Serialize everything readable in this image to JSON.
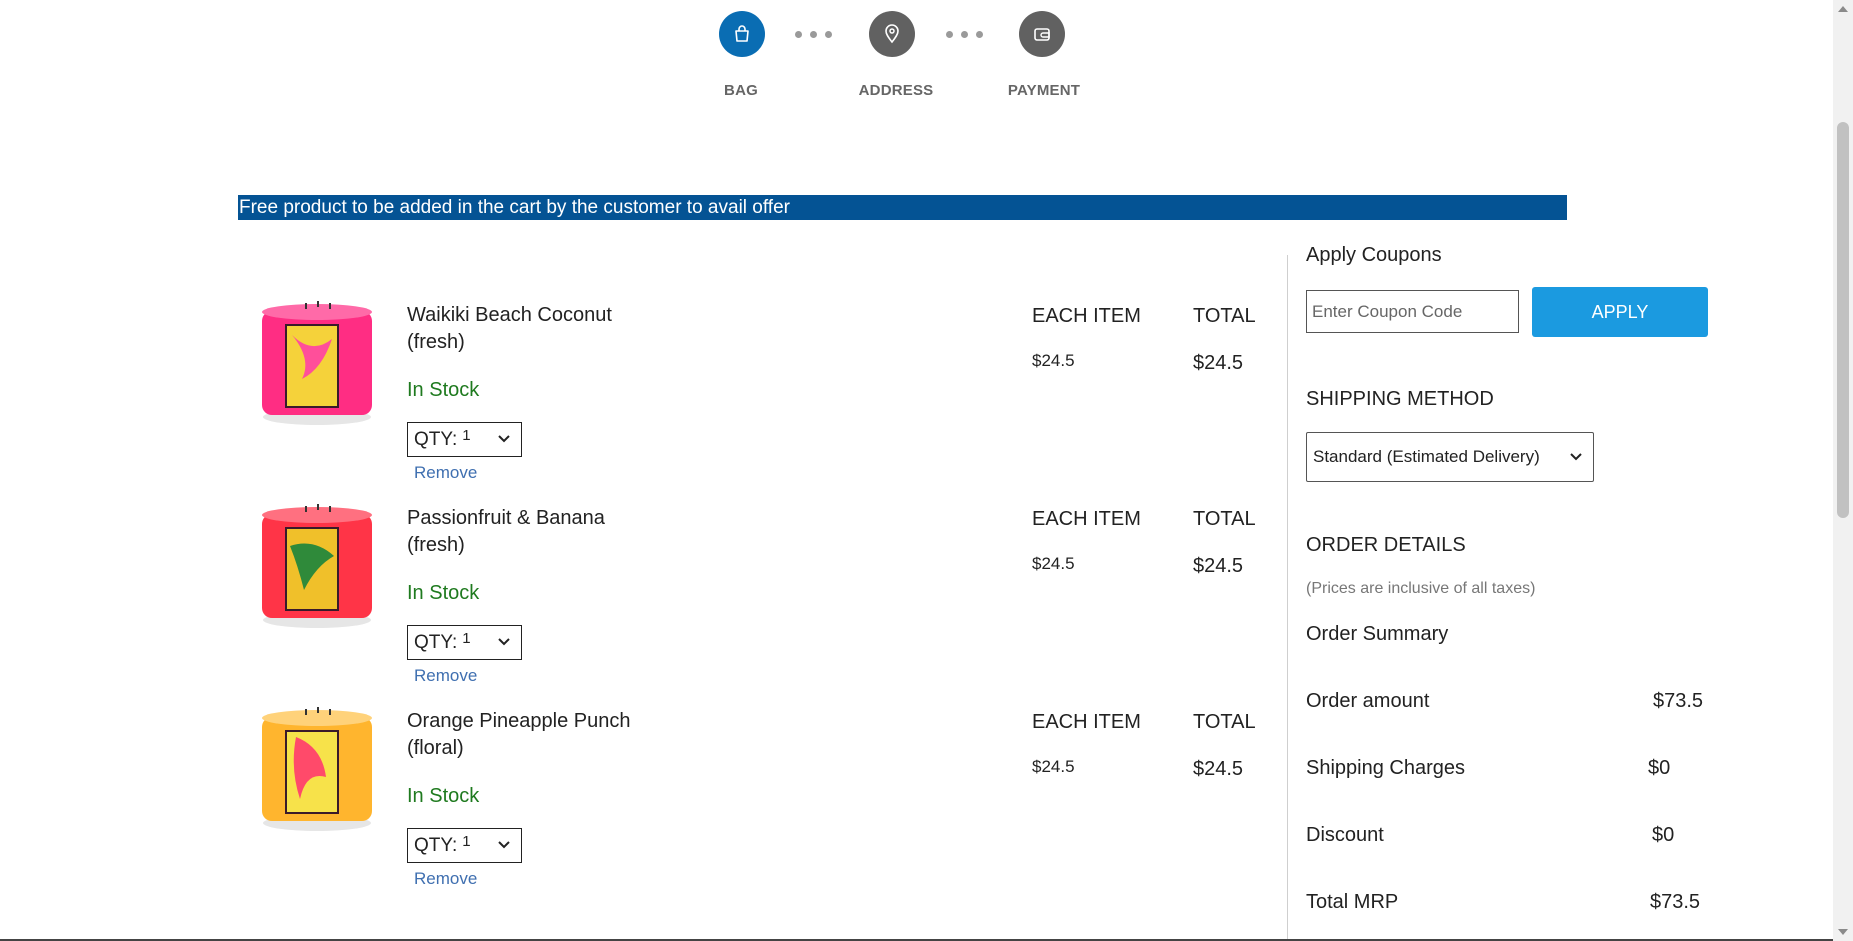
{
  "stepper": {
    "steps": [
      {
        "label": "BAG",
        "icon": "bag-icon",
        "state": "active"
      },
      {
        "label": "ADDRESS",
        "icon": "location-pin-icon",
        "state": "inactive"
      },
      {
        "label": "PAYMENT",
        "icon": "wallet-icon",
        "state": "inactive"
      }
    ]
  },
  "banner": {
    "text": "Free product to be added in the cart by the customer to avail offer"
  },
  "cart": {
    "items": [
      {
        "name": "Waikiki Beach Coconut (fresh)",
        "stock": "In Stock",
        "qty_label": "QTY:",
        "qty_value": "1",
        "remove": "Remove",
        "each_header": "EACH ITEM",
        "each_price": "$24.5",
        "total_header": "TOTAL",
        "total_price": "$24.5",
        "candle_color": "#ff2d83",
        "label_color": "#f5d23a"
      },
      {
        "name": "Passionfruit & Banana (fresh)",
        "stock": "In Stock",
        "qty_label": "QTY:",
        "qty_value": "1",
        "remove": "Remove",
        "each_header": "EACH ITEM",
        "each_price": "$24.5",
        "total_header": "TOTAL",
        "total_price": "$24.5",
        "candle_color": "#ff3447",
        "label_color": "#f0c02a"
      },
      {
        "name": "Orange Pineapple Punch (floral)",
        "stock": "In Stock",
        "qty_label": "QTY:",
        "qty_value": "1",
        "remove": "Remove",
        "each_header": "EACH ITEM",
        "each_price": "$24.5",
        "total_header": "TOTAL",
        "total_price": "$24.5",
        "candle_color": "#ffb52e",
        "label_color": "#f7e24a"
      }
    ]
  },
  "coupons": {
    "title": "Apply Coupons",
    "placeholder": "Enter Coupon Code",
    "apply_label": "APPLY"
  },
  "shipping": {
    "title": "SHIPPING METHOD",
    "selected": "Standard (Estimated Delivery)"
  },
  "order": {
    "title": "ORDER DETAILS",
    "note": "(Prices are inclusive of all taxes)",
    "summary_title": "Order Summary",
    "rows": [
      {
        "label": "Order amount",
        "value": "$73.5"
      },
      {
        "label": "Shipping Charges",
        "value": "$0"
      },
      {
        "label": "Discount",
        "value": "$0"
      },
      {
        "label": "Total MRP",
        "value": "$73.5"
      }
    ]
  },
  "colors": {
    "accent": "#0a6db3",
    "banner": "#045394",
    "apply_button": "#1b9ae0",
    "in_stock": "#1f7a1f",
    "remove_link": "#3f6fb0"
  }
}
